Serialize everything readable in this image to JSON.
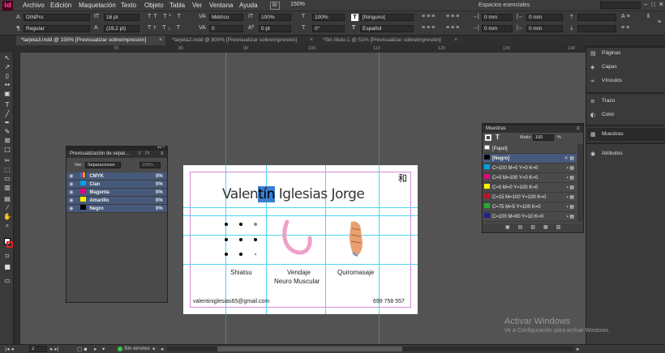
{
  "app": {
    "logo": "Id"
  },
  "menu": [
    "Archivo",
    "Edición",
    "Maquetación",
    "Texto",
    "Objeto",
    "Tabla",
    "Ver",
    "Ventana",
    "Ayuda"
  ],
  "menu_extra": {
    "br": "Br",
    "zoom": "150%",
    "workspace": "Espacios esenciales"
  },
  "control": {
    "font": "DINPro",
    "style": "Regular",
    "size": "16 pt",
    "leading": "(19,2 pt)",
    "kerning": "Métrico",
    "tracking": "0",
    "scale_v": "100%",
    "scale_h": "100%",
    "baseline": "0 pt",
    "skew": "0°",
    "a_label": "a",
    "swatch": "[Ninguno]",
    "language": "Español",
    "indent1": "0 mm",
    "indent2": "0 mm",
    "indent3": "0 mm",
    "indent4": "0 mm"
  },
  "tabs": [
    "*tarjeta3.indd @ 150% [Previsualizar sobreimpresión]",
    "*tarjeta2.indd @ 800% [Previsualizar sobreimpresión]",
    "*Sin título-1 @ 51% [Previsualizar sobreimpresión]"
  ],
  "ruler": [
    "70",
    "80",
    "90",
    "100",
    "110",
    "120",
    "130",
    "140"
  ],
  "dock": [
    {
      "label": "Páginas",
      "icon": "pages-icon",
      "glyph": "▤"
    },
    {
      "label": "Capas",
      "icon": "layers-icon",
      "glyph": "◈"
    },
    {
      "label": "Vínculos",
      "icon": "links-icon",
      "glyph": "∞"
    },
    {
      "label": "Trazo",
      "icon": "stroke-icon",
      "glyph": "≡"
    },
    {
      "label": "Color",
      "icon": "color-icon",
      "glyph": "◐"
    },
    {
      "label": "Muestras",
      "icon": "swatches-icon",
      "glyph": "▦"
    },
    {
      "label": "Atributos",
      "icon": "attributes-icon",
      "glyph": "◉"
    }
  ],
  "sep_panel": {
    "title": "Previsualización de separ...",
    "tabs": [
      "V",
      "Pr"
    ],
    "view_label": "Ver:",
    "view_value": "Separaciones",
    "pct": "100%",
    "rows": [
      {
        "name": "CMYK",
        "value": "0%",
        "color": "#888"
      },
      {
        "name": "Cian",
        "value": "0%",
        "color": "#00a0e9"
      },
      {
        "name": "Magenta",
        "value": "0%",
        "color": "#e4007f"
      },
      {
        "name": "Amarillo",
        "value": "0%",
        "color": "#fff100"
      },
      {
        "name": "Negro",
        "value": "0%",
        "color": "#000000"
      }
    ]
  },
  "swatches_panel": {
    "title": "Muestras",
    "tint_label": "Matiz:",
    "tint": "100",
    "pct": "%",
    "rows": [
      {
        "name": "[Papel]",
        "color": "#ffffff"
      },
      {
        "name": "[Negro]",
        "color": "#000000"
      },
      {
        "name": "C=100 M=0 Y=0 K=0",
        "color": "#00a0e9"
      },
      {
        "name": "C=0 M=100 Y=0 K=0",
        "color": "#e4007f"
      },
      {
        "name": "C=0 M=0 Y=100 K=0",
        "color": "#fff100"
      },
      {
        "name": "C=15 M=100 Y=100 K=0",
        "color": "#c30d23"
      },
      {
        "name": "C=75 M=5 Y=100 K=0",
        "color": "#22ac38"
      },
      {
        "name": "C=100 M=90 Y=10 K=0",
        "color": "#1d2088"
      }
    ]
  },
  "card": {
    "name_sel": "tín",
    "name_a": "Valen",
    "name_b": "Iglesias Jorge",
    "kanji": "和",
    "svc1": "Shiatsu",
    "svc2a": "Vendaje",
    "svc2b": "Neuro Muscular",
    "svc3": "Quiromasaje",
    "email": "valentiniglesias65@gmail.com",
    "phone": "699 758 557"
  },
  "status": {
    "page": "2",
    "errors": "Sin errores"
  },
  "watermark": {
    "line1": "Activar Windows",
    "line2": "Ve a Configuración para activar Windows."
  }
}
